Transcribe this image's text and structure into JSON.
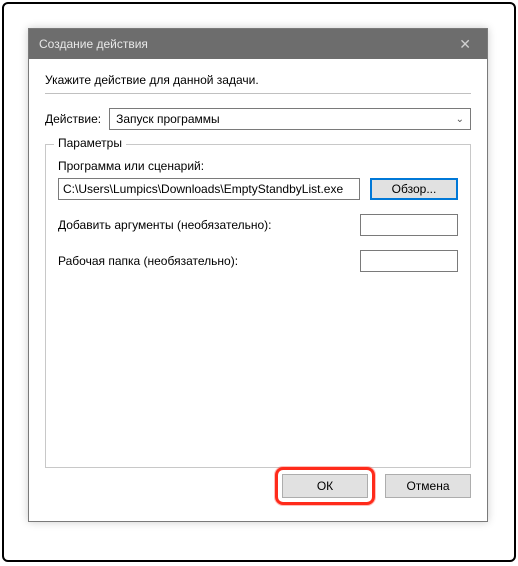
{
  "titlebar": {
    "title": "Создание действия",
    "close": "✕"
  },
  "content": {
    "instruction": "Укажите действие для данной задачи.",
    "action_label": "Действие:",
    "action_value": "Запуск программы"
  },
  "params": {
    "legend": "Параметры",
    "program_label": "Программа или сценарий:",
    "program_value": "C:\\Users\\Lumpics\\Downloads\\EmptyStandbyList.exe",
    "browse_label": "Обзор...",
    "args_label": "Добавить аргументы (необязательно):",
    "args_value": "",
    "startin_label": "Рабочая папка (необязательно):",
    "startin_value": ""
  },
  "buttons": {
    "ok": "ОК",
    "cancel": "Отмена"
  }
}
